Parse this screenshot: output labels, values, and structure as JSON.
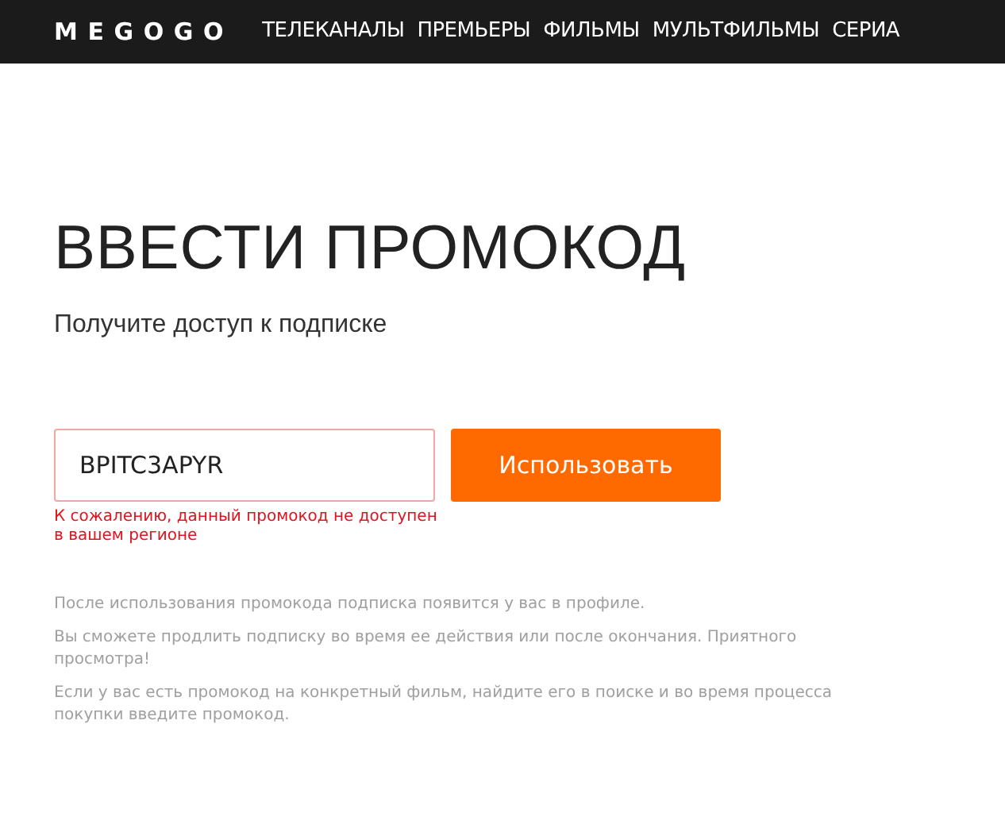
{
  "header": {
    "logo": "MEGOGO",
    "nav": [
      {
        "label": "ТЕЛЕКАНАЛЫ"
      },
      {
        "label": "ПРЕМЬЕРЫ"
      },
      {
        "label": "ФИЛЬМЫ"
      },
      {
        "label": "МУЛЬТФИЛЬМЫ"
      },
      {
        "label": "СЕРИА"
      }
    ]
  },
  "title": "ВВЕСТИ ПРОМОКОД",
  "subtitle": "Получите доступ к подписке",
  "promo_field": {
    "value": "BPITC3APYR",
    "invalid": true,
    "error": "К сожалению, данный промокод не доступен в вашем регионе"
  },
  "submit_button": "Использовать",
  "notes": [
    "После использования промокода подписка появится у вас в профиле.",
    "Вы сможете продлить подписку во время ее действия или после окончания. Приятного просмотра!",
    "Если у вас есть промокод на конкретный фильм, найдите его в поиске и во время процесса покупки введите промокод."
  ]
}
